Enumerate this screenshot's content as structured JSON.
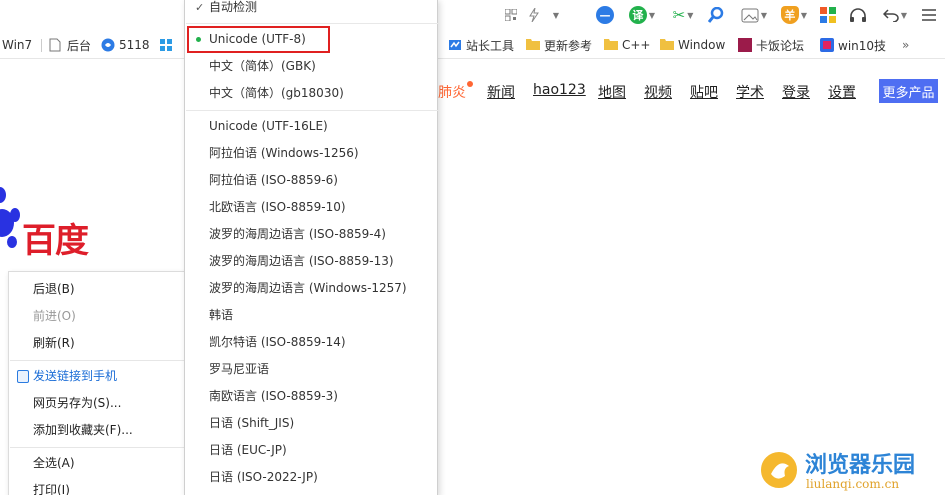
{
  "toolbar": {
    "icons": [
      "qr-icon",
      "lightning-icon",
      "chevron-down-icon",
      "minus-circle-icon",
      "translate-icon",
      "scissors-icon",
      "search-icon",
      "image-icon",
      "shield-icon",
      "apps-icon",
      "headphones-icon",
      "undo-icon",
      "menu-icon"
    ],
    "translate_label": "译",
    "shield_label": "羊",
    "colors": {
      "blue": "#2c7be5",
      "green": "#22b14c",
      "orange": "#f0a020"
    }
  },
  "bookmarks": {
    "left": [
      {
        "label": "Win7"
      },
      {
        "label": "后台"
      },
      {
        "label": "5118"
      }
    ],
    "right": [
      {
        "label": "站长工具"
      },
      {
        "label": "更新参考"
      },
      {
        "label": "C++"
      },
      {
        "label": "Window"
      },
      {
        "label": "卡饭论坛"
      },
      {
        "label": "win10技"
      }
    ],
    "more": "»"
  },
  "page": {
    "nav_partial": "肺炎",
    "nav": [
      "新闻",
      "hao123",
      "地图",
      "视频",
      "贴吧",
      "学术",
      "登录",
      "设置"
    ],
    "more_products": "更多产品",
    "logo_text": "百度",
    "accent": "#4e6ef2",
    "logo_color": "#de1e2a"
  },
  "context_menu": {
    "items": [
      {
        "label": "后退(B)",
        "disabled": false
      },
      {
        "label": "前进(O)",
        "disabled": true
      },
      {
        "label": "刷新(R)",
        "disabled": false
      },
      {
        "label": "发送链接到手机",
        "disabled": false
      },
      {
        "label": "网页另存为(S)...",
        "disabled": false
      },
      {
        "label": "添加到收藏夹(F)...",
        "disabled": false
      },
      {
        "label": "全选(A)",
        "disabled": false
      },
      {
        "label": "打印(I)",
        "disabled": false
      }
    ]
  },
  "encoding_menu": {
    "auto_detect": "自动检测",
    "selected": "Unicode (UTF-8)",
    "group1": [
      "中文（简体）(GBK)",
      "中文（简体）(gb18030)"
    ],
    "group2": [
      "Unicode (UTF-16LE)",
      "阿拉伯语 (Windows-1256)",
      "阿拉伯语 (ISO-8859-6)",
      "北欧语言 (ISO-8859-10)",
      "波罗的海周边语言 (ISO-8859-4)",
      "波罗的海周边语言 (ISO-8859-13)",
      "波罗的海周边语言 (Windows-1257)",
      "韩语",
      "凯尔特语 (ISO-8859-14)",
      "罗马尼亚语",
      "南欧语言 (ISO-8859-3)",
      "日语 (Shift_JIS)",
      "日语 (EUC-JP)",
      "日语 (ISO-2022-JP)"
    ]
  },
  "watermark": {
    "title": "浏览器乐园",
    "url": "liulanqi.com.cn"
  }
}
